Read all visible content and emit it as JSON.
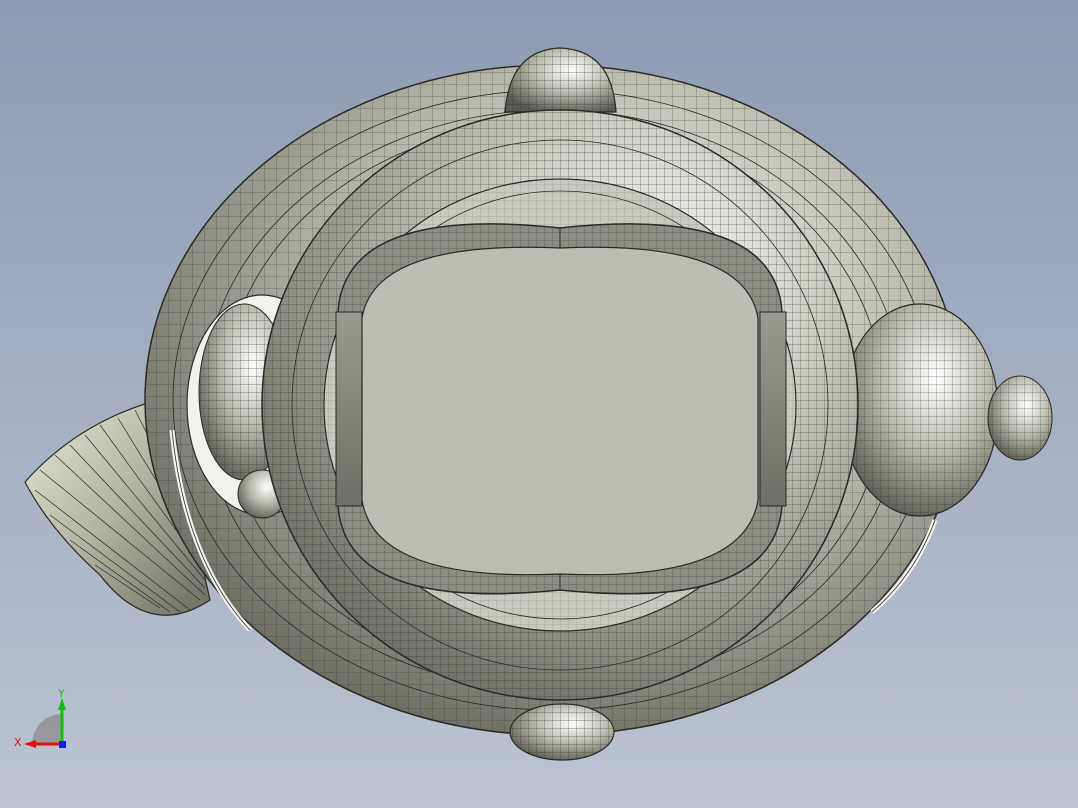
{
  "viewport": {
    "background_top": "#8d9cb3",
    "background_bottom": "#bcc4d2"
  },
  "model": {
    "shade_color": "#c8c8bd",
    "edge_color": "#2b2b26"
  },
  "triad": {
    "x_label": "X",
    "y_label": "Y",
    "x_color": "#e01010",
    "y_color": "#10c010",
    "z_color": "#1020e0"
  }
}
